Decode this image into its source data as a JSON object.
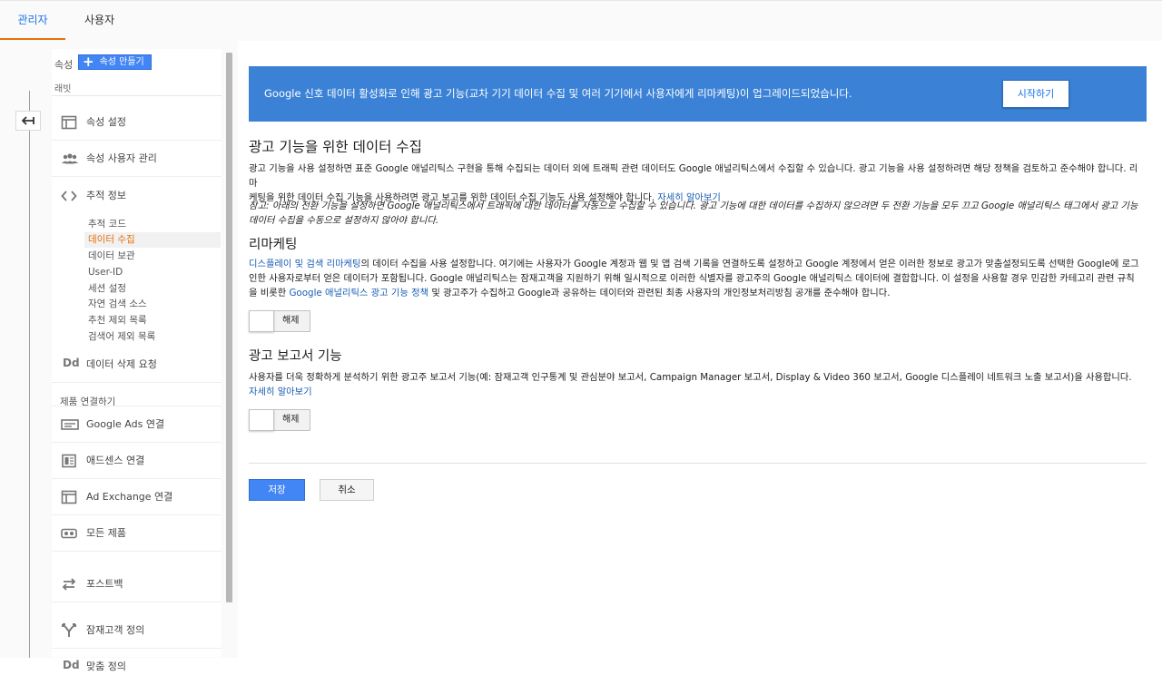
{
  "tabs": {
    "admin": "관리자",
    "user": "사용자"
  },
  "sidebar": {
    "property_label": "속성",
    "create_property": "속성 만들기",
    "rabbit_label": "래빗",
    "items": [
      {
        "label": "속성 설정",
        "icon": "window-icon"
      },
      {
        "label": "속성 사용자 관리",
        "icon": "people-icon"
      },
      {
        "label": "추적 정보",
        "icon": "code-icon"
      }
    ],
    "tracking_sub": [
      "추적 코드",
      "데이터 수집",
      "데이터 보관",
      "User-ID",
      "세션 설정",
      "자연 검색 소스",
      "추천 제외 목록",
      "검색어 제외 목록"
    ],
    "data_deletion": "데이터 삭제 요청",
    "product_linking_header": "제품 연결하기",
    "linking": [
      {
        "label": "Google Ads 연결",
        "icon": "ads-icon"
      },
      {
        "label": "애드센스 연결",
        "icon": "adsense-icon"
      },
      {
        "label": "Ad Exchange 연결",
        "icon": "window-icon"
      },
      {
        "label": "모든 제품",
        "icon": "link-icon"
      }
    ],
    "postback": "포스트백",
    "audience_def": "잠재고객 정의",
    "custom_def": "맞춤 정의"
  },
  "banner": {
    "text": "Google 신호 데이터 활성화로 인해 광고 기능(교차 기기 데이터 수집 및 여러 기기에서 사용자에게 리마케팅)이 업그레이드되었습니다.",
    "button": "시작하기"
  },
  "main": {
    "section1": {
      "title": "광고 기능을 위한 데이터 수집",
      "para_line1": "광고 기능을 사용 설정하면 표준 Google 애널리틱스 구현을 통해 수집되는 데이터 외에 트래픽 관련 데이터도 Google 애널리틱스에서 수집할 수 있습니다. 광고 기능을 사용 설정하려면 해당 정책을 검토하고 준수해야 합니다. 리마",
      "para_line2": "케팅을 위한 데이터 수집 기능을 사용하려면 광고 보고를 위한 데이터 수집 기능도 사용 설정해야 합니다. ",
      "learn_more": "자세히 알아보기",
      "note": "참고: 아래의 전환 기능을 설정하면 Google 애널리틱스에서 트래픽에 대한 데이터를 자동으로 수집할 수 있습니다. 광고 기능에 대한 데이터를 수집하지 않으려면 두 전환 기능을 모두 끄고 Google 애널리틱스 태그에서 광고 기능 데이터 수집을 수동으로 설정하지 않아야 합니다."
    },
    "remarketing": {
      "title": "리마케팅",
      "link1": "디스플레이 및 검색 리마케팅",
      "text1": "의 데이터 수집을 사용 설정합니다. 여기에는 사용자가 Google 계정과 웹 및 앱 검색 기록을 연결하도록 설정하고 Google 계정에서 얻은 이러한 정보로 광고가 맞춤설정되도록 선택한 Google에 로그인한 사용자로부터 얻은 데이터가 포함됩니다. Google 애널리틱스는 잠재고객을 지원하기 위해 일시적으로 이러한 식별자를 광고주의 Google 애널리틱스 데이터에 결합합니다. 이 설정을 사용할 경우 민감한 카테고리 관련 규칙을 비롯한 ",
      "link2": "Google 애널리틱스 광고 기능 정책",
      "text2": " 및 광고주가 수집하고 Google과 공유하는 데이터와 관련된 최종 사용자의 개인정보처리방침 공개를 준수해야 합니다.",
      "toggle": "해제"
    },
    "reporting": {
      "title": "광고 보고서 기능",
      "text": "사용자를 더욱 정확하게 분석하기 위한 광고주 보고서 기능(예: 잠재고객 인구통계 및 관심분야 보고서, Campaign Manager 보고서, Display & Video 360 보고서, Google 디스플레이 네트워크 노출 보고서)을 사용합니다. ",
      "learn_more": "자세히 알아보기",
      "toggle": "해제"
    },
    "save": "저장",
    "cancel": "취소"
  },
  "colors": {
    "accent_blue": "#4285f4",
    "banner_blue": "#3b82d6",
    "active_orange": "#e8710a",
    "link": "#1a5fb4"
  }
}
